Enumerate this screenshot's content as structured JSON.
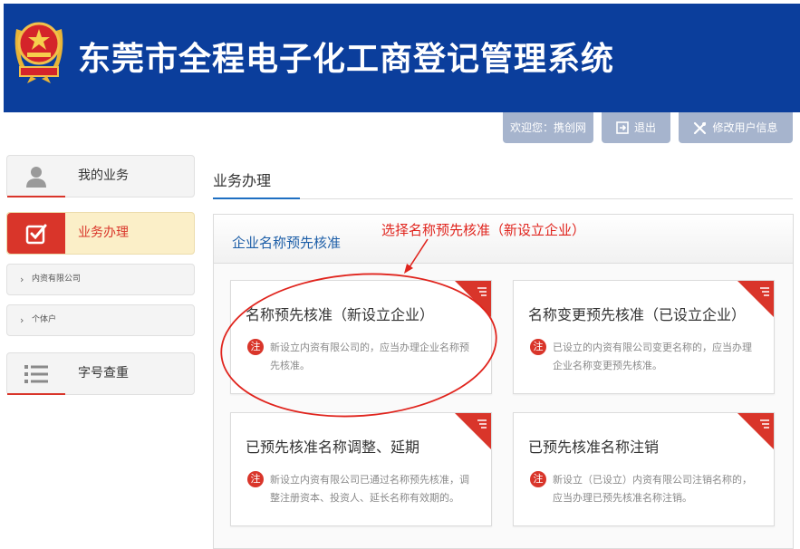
{
  "header": {
    "title": "东莞市全程电子化工商登记管理系统",
    "emblem_icon": "national-emblem-icon",
    "bg_color": "#0b3e9c"
  },
  "userbar": {
    "welcome": "欢迎您：携创网",
    "logout": "退出",
    "edit_profile": "修改用户信息"
  },
  "sidebar": {
    "items": [
      {
        "label": "我的业务",
        "icon": "user-icon",
        "active": false
      },
      {
        "label": "业务办理",
        "icon": "checkbox-icon",
        "active": true
      },
      {
        "label": "字号查重",
        "icon": "list-icon",
        "active": false
      }
    ],
    "sub_items": [
      {
        "label": "内资有限公司"
      },
      {
        "label": "个体户"
      }
    ]
  },
  "main": {
    "tab": "业务办理",
    "panel_title": "企业名称预先核准",
    "annotation": "选择名称预先核准（新设立企业）",
    "cards": [
      {
        "title": "名称预先核准（新设立企业）",
        "note_badge": "注",
        "desc": "新设立内资有限公司的，应当办理企业名称预先核准。"
      },
      {
        "title": "名称变更预先核准（已设立企业）",
        "note_badge": "注",
        "desc": "已设立的内资有限公司变更名称的，应当办理企业名称变更预先核准。"
      },
      {
        "title": "已预先核准名称调整、延期",
        "note_badge": "注",
        "desc": "新设立内资有限公司已通过名称预先核准，调整注册资本、投资人、延长名称有效期的。"
      },
      {
        "title": "已预先核准名称注销",
        "note_badge": "注",
        "desc": "新设立（已设立）内资有限公司注销名称的，应当办理已预先核准名称注销。"
      }
    ]
  },
  "colors": {
    "accent_red": "#d9352a",
    "link_blue": "#1e5fa8",
    "userbar_gray": "#a6b4cd"
  }
}
